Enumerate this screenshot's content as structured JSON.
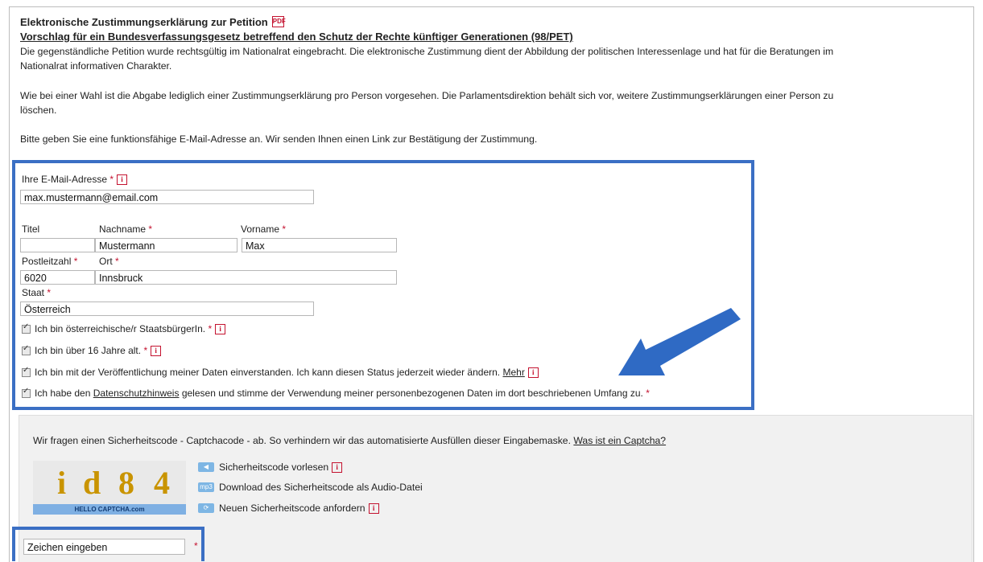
{
  "header": {
    "title": "Elektronische Zustimmungserklärung zur Petition",
    "pdf_icon": "PDF",
    "subtitle": "Vorschlag für ein Bundesverfassungsgesetz betreffend den Schutz der Rechte künftiger Generationen (98/PET)",
    "para1_line1": "Die gegenständliche Petition wurde rechtsgültig im Nationalrat eingebracht. Die elektronische Zustimmung dient der Abbildung der politischen Interessenlage und hat für die Beratungen im",
    "para1_line2": "Nationalrat informativen Charakter.",
    "para2_line1": "Wie bei einer Wahl ist die Abgabe lediglich einer Zustimmungserklärung pro Person vorgesehen. Die Parlamentsdirektion behält sich vor, weitere Zustimmungserklärungen einer Person zu",
    "para2_line2": "löschen.",
    "para3": "Bitte geben Sie eine funktionsfähige E-Mail-Adresse an. Wir senden Ihnen einen Link zur Bestätigung der Zustimmung."
  },
  "form": {
    "email_label": "Ihre E-Mail-Adresse",
    "email_value": "max.mustermann@email.com",
    "titel_label": "Titel",
    "titel_value": "",
    "nachname_label": "Nachname",
    "nachname_value": "Mustermann",
    "vorname_label": "Vorname",
    "vorname_value": "Max",
    "plz_label": "Postleitzahl",
    "plz_value": "6020",
    "ort_label": "Ort",
    "ort_value": "Innsbruck",
    "staat_label": "Staat",
    "staat_value": "Österreich",
    "required_mark": "*",
    "info_icon": "i"
  },
  "checks": [
    {
      "text": "Ich bin österreichische/r StaatsbürgerIn.",
      "checked": true
    },
    {
      "text": "Ich bin über 16 Jahre alt.",
      "checked": true
    },
    {
      "text": "Ich bin mit der Veröffentlichung meiner Daten einverstanden. Ich kann diesen Status jederzeit wieder ändern.",
      "link": "Mehr",
      "checked": true
    },
    {
      "pre": "Ich habe den",
      "link": "Datenschutzhinweis",
      "post": "gelesen und stimme der Verwendung meiner personenbezogenen Daten im dort beschriebenen Umfang zu.",
      "checked": true
    }
  ],
  "captcha": {
    "intro": "Wir fragen einen Sicherheitscode - Captchacode - ab. So verhindern wir das automatisierte Ausfüllen dieser Eingabemaske.",
    "intro_link": "Was ist ein Captcha?",
    "code_chars": [
      "i",
      "d",
      "8",
      "4"
    ],
    "brand": "HELLO CAPTCHA.com",
    "read_aloud": "Sicherheitscode vorlesen",
    "download_audio": "Download des Sicherheitscode als Audio-Datei",
    "audio_badge": "mp3",
    "new_code": "Neuen Sicherheitscode anfordern",
    "input_value": "Zeichen eingeben",
    "required_mark": "*"
  },
  "colors": {
    "highlight_box": "#3b6fc4",
    "arrow": "#2f6ac4",
    "required": "#c4122f",
    "captcha_panel": "#f1f1f1"
  }
}
